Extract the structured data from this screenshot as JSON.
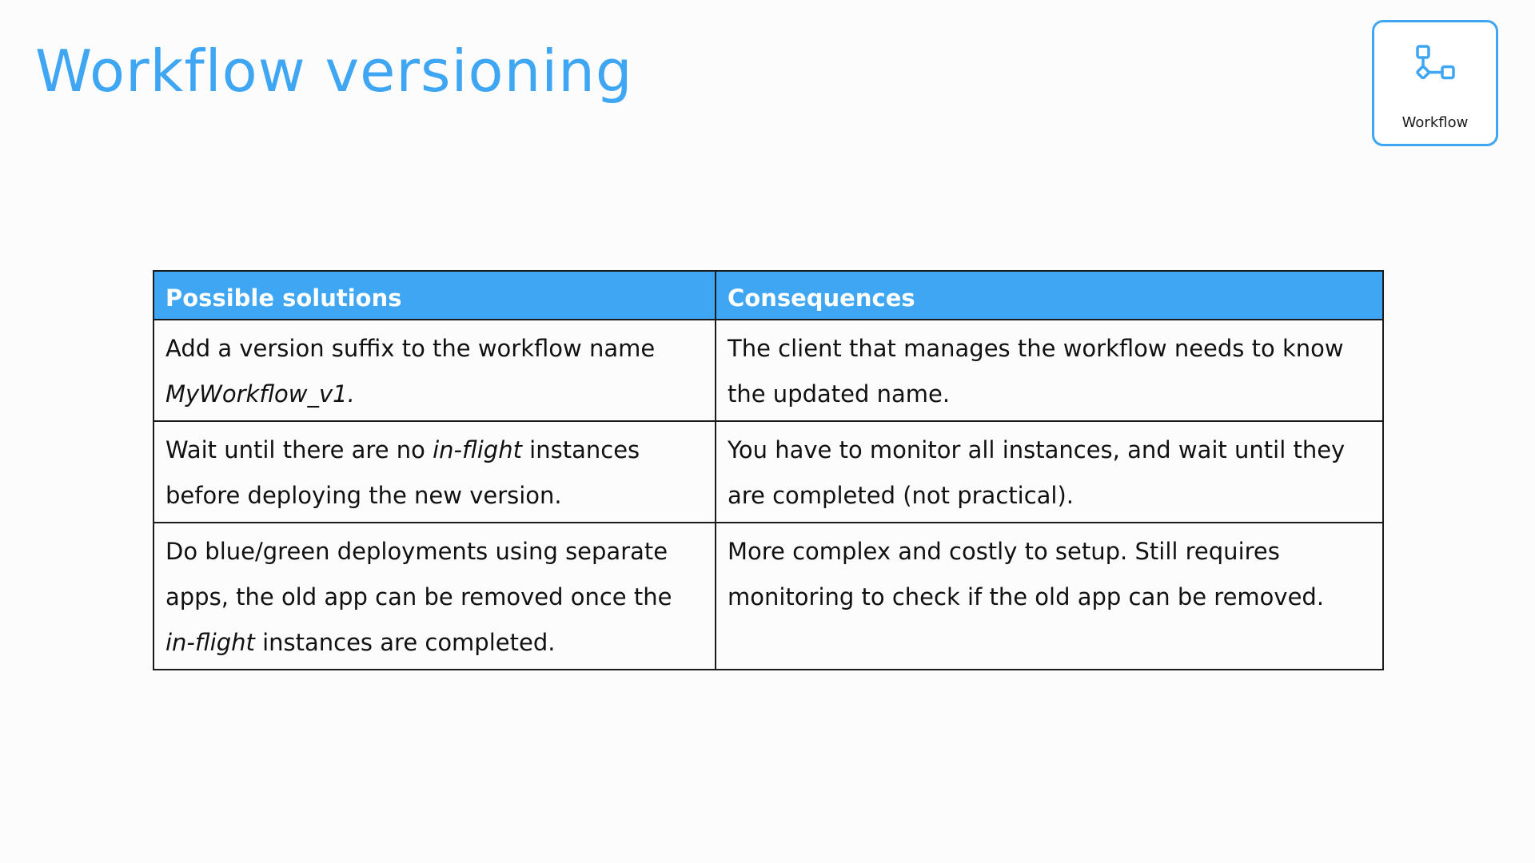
{
  "slide": {
    "title": "Workflow versioning"
  },
  "badge": {
    "icon": "workflow-icon",
    "label": "Workflow",
    "accent_color": "#3ea6f2"
  },
  "table": {
    "header_color": "#3ea6f2",
    "headers": [
      "Possible solutions",
      "Consequences"
    ],
    "rows": [
      {
        "solution": {
          "before": "Add a version suffix to the workflow name ",
          "emphasis": "MyWorkflow_v1.",
          "after": ""
        },
        "consequence": "The client that manages the workflow needs to know the updated name."
      },
      {
        "solution": {
          "before": "Wait until there are no ",
          "emphasis": "in-flight",
          "after": " instances before deploying the new version."
        },
        "consequence": "You have to monitor all instances, and wait until they are completed (not practical)."
      },
      {
        "solution": {
          "before": "Do blue/green deployments using separate apps, the old app can be removed once the ",
          "emphasis": "in-flight",
          "after": " instances are completed."
        },
        "consequence": "More complex and costly to setup. Still requires monitoring to check if the old app can be removed."
      }
    ]
  }
}
